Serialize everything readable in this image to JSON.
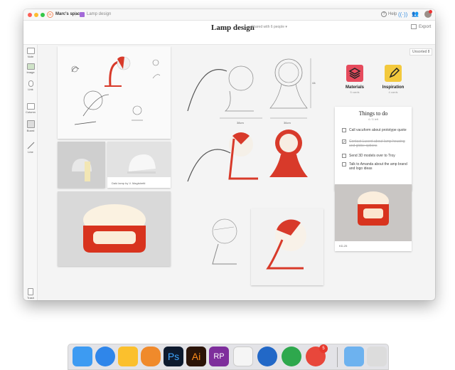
{
  "window": {
    "space_name": "Marc's space",
    "space_initial": "m",
    "board_name": "Lamp design",
    "help_label": "Help",
    "page_title": "Lamp design",
    "shared_label": "Shared with 6 people",
    "export_label": "Export",
    "unsorted_label": "Unsorted 8"
  },
  "toolbar": {
    "items": [
      {
        "label": "Note",
        "icon": "note-icon"
      },
      {
        "label": "Image",
        "icon": "image-icon"
      },
      {
        "label": "Link",
        "icon": "link-icon"
      },
      {
        "label": "Column",
        "icon": "column-icon"
      },
      {
        "label": "Board",
        "icon": "board-icon"
      },
      {
        "label": "Line",
        "icon": "line-icon"
      }
    ],
    "trash_label": "Trash"
  },
  "canvas": {
    "caption_dalu": "Dalù lamp by V. Magistretti",
    "caption_kd": "KD-25",
    "dim_labels": [
      "38cm",
      "36cm",
      "44cm"
    ],
    "categories": [
      {
        "label": "Materials",
        "sub": "5 cards",
        "color": "#e64b5d"
      },
      {
        "label": "Inspiration",
        "sub": "4 cards",
        "color": "#f3c93d"
      }
    ],
    "todo": {
      "title": "Things to do",
      "sub": "4 / 5 left",
      "items": [
        {
          "text": "Call vacuform about prototype quote",
          "done": false
        },
        {
          "text": "Contact Lucent about lamp housing and globe options",
          "done": true
        },
        {
          "text": "Send 3D models over to Troy",
          "done": false
        },
        {
          "text": "Talk to Amanda about the amp brand and logo ideas",
          "done": false
        }
      ]
    }
  },
  "dock": {
    "apps": [
      "finder-icon",
      "safari-icon",
      "sketch-icon",
      "blimp-icon",
      "photoshop-icon",
      "illustrator-icon",
      "rp-icon",
      "notes-icon",
      "1password-icon",
      "cleaner-icon",
      "airmail-icon",
      "downloads-icon",
      "trash-icon"
    ],
    "badge_count": "5",
    "ps_label": "Ps",
    "ai_label": "Ai",
    "rp_label": "RP"
  },
  "colors": {
    "accent_red": "#d83a2a",
    "window_bg": "#f4f4f4"
  }
}
